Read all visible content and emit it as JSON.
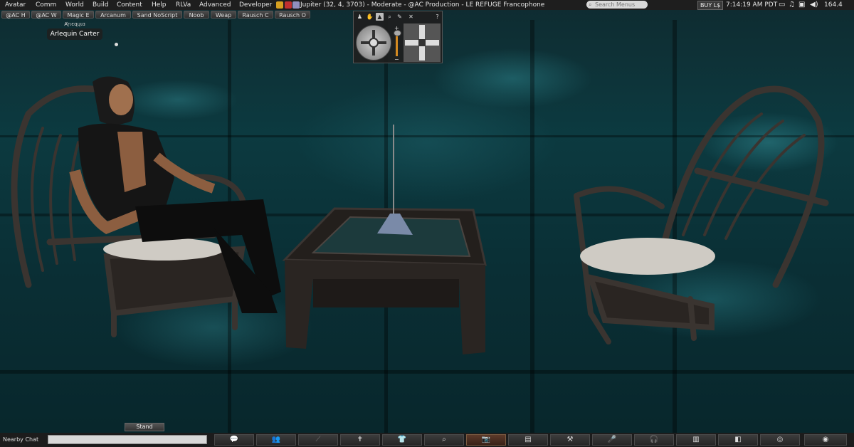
{
  "menubar": {
    "items": [
      "Avatar",
      "Comm",
      "World",
      "Build",
      "Content",
      "Help",
      "RLVa",
      "Advanced",
      "Developer"
    ],
    "location": "Jupiter (32, 4, 3703) - Moderate - @AC Production - LE REFUGE Francophone",
    "search_placeholder": "Search Menus",
    "buy_label": "BUY L$",
    "time": "7:14:19 AM PDT",
    "fps": "164.4"
  },
  "favorites": [
    "@AC H",
    "@AC W",
    "Magic E",
    "Arcanum",
    "Sand NoScript",
    "Noob",
    "Weap",
    "Rausch C",
    "Rausch O"
  ],
  "nametag": {
    "display_small": "Ⱥɼɩєɋɥɩɑ",
    "name": "Arlequin Carter"
  },
  "camera": {
    "help_label": "?",
    "zoom_plus": "+",
    "zoom_minus": "−",
    "tabs": [
      "person-icon",
      "hand-icon",
      "avatar-view-icon",
      "object-view-icon",
      "camera-presets-icon",
      "close-icon"
    ]
  },
  "stand_label": "Stand",
  "bottombar": {
    "chat_label": "Nearby Chat",
    "buttons": [
      "chat-icon",
      "people-icon",
      "gestures-icon",
      "move-icon",
      "appearance-icon",
      "search-icon",
      "snapshot-icon",
      "inventory-icon",
      "build-icon",
      "voice-icon",
      "sound-icon",
      "map-icon",
      "minimap-icon",
      "radar-icon",
      "view-icon"
    ]
  },
  "colors": {
    "background_accent": "#0c3a40",
    "zoom_slider": "#d58a20",
    "menubar": "#1e1e1e"
  }
}
